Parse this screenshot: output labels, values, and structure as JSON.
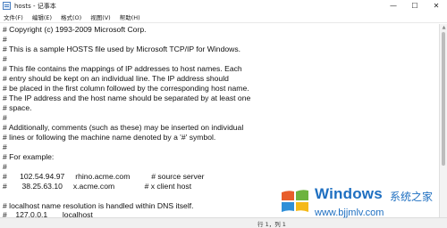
{
  "window": {
    "title": "hosts - 记事本",
    "controls": {
      "minimize": "—",
      "maximize": "☐",
      "close": "✕"
    }
  },
  "menu": {
    "items": [
      {
        "label": "文件(F)"
      },
      {
        "label": "编辑(E)"
      },
      {
        "label": "格式(O)"
      },
      {
        "label": "视图(V)"
      },
      {
        "label": "帮助(H)"
      }
    ]
  },
  "editor": {
    "lines": [
      "# Copyright (c) 1993-2009 Microsoft Corp.",
      "#",
      "# This is a sample HOSTS file used by Microsoft TCP/IP for Windows.",
      "#",
      "# This file contains the mappings of IP addresses to host names. Each",
      "# entry should be kept on an individual line. The IP address should",
      "# be placed in the first column followed by the corresponding host name.",
      "# The IP address and the host name should be separated by at least one",
      "# space.",
      "#",
      "# Additionally, comments (such as these) may be inserted on individual",
      "# lines or following the machine name denoted by a '#' symbol.",
      "#",
      "# For example:",
      "#",
      "#      102.54.94.97     rhino.acme.com          # source server",
      "#       38.25.63.10     x.acme.com              # x client host",
      "",
      "# localhost name resolution is handled within DNS itself.",
      "#\t127.0.0.1       localhost"
    ]
  },
  "status": {
    "position": "行 1，列 1"
  },
  "watermark": {
    "brand": "Windows",
    "brand_cn": "系统之家",
    "url": "www.bjjmlv.com"
  },
  "colors": {
    "watermark_blue": "#1e6fc1"
  }
}
